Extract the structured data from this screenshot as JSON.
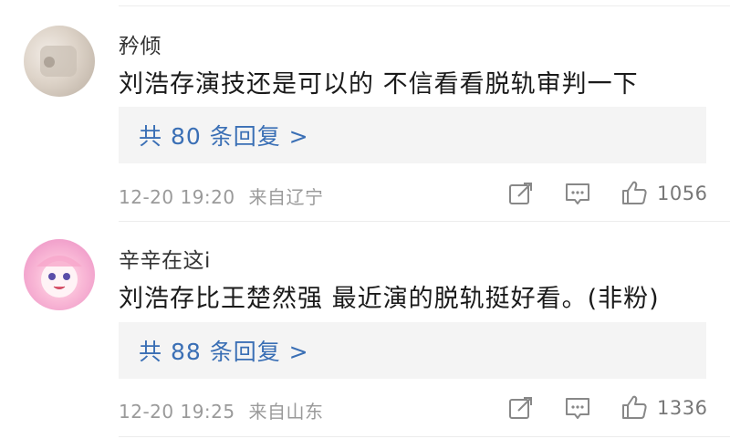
{
  "comments": [
    {
      "username": "矜倾",
      "text": "刘浩存演技还是可以的  不信看看脱轨审判一下",
      "replies_label": "共 80 条回复 >",
      "time": "12-20 19:20",
      "location": "来自辽宁",
      "likes": "1056"
    },
    {
      "username": "辛辛在这i",
      "text": "刘浩存比王楚然强   最近演的脱轨挺好看。(非粉)",
      "replies_label": "共 88 条回复 >",
      "time": "12-20 19:25",
      "location": "来自山东",
      "likes": "1336"
    }
  ],
  "icons": {
    "share": "share-icon",
    "reply": "comment-icon",
    "like": "thumbs-up-icon"
  },
  "colors": {
    "link_blue": "#3a6fb5",
    "meta_gray": "#9a9a9a",
    "reply_bg": "#f4f4f4"
  }
}
